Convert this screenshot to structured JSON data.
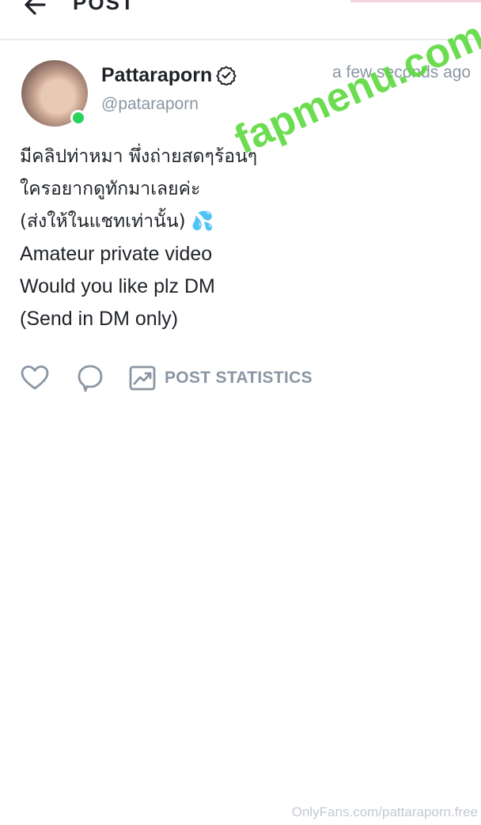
{
  "header": {
    "title": "POST",
    "back_icon": "arrow-left-icon"
  },
  "post": {
    "author": {
      "display_name": "Pattaraporn",
      "username": "@pataraporn",
      "verified_icon": "verified-badge-icon",
      "online": true,
      "online_color": "#2bd35b"
    },
    "timestamp": "a few seconds ago",
    "text_lines": [
      "มีคลิปท่าหมา พึ่งถ่ายสดๆร้อนๆ",
      "ใครอยากดูทักมาเลยค่ะ",
      "(ส่งให้ในแชทเท่านั้น) 💦",
      "Amateur private video",
      "Would you like plz DM",
      "(Send in DM only)"
    ],
    "actions": {
      "like_icon": "heart-icon",
      "comment_icon": "comment-icon",
      "stats_icon": "chart-icon",
      "stats_label": "POST STATISTICS"
    }
  },
  "watermark": "fapmenu.com",
  "footer_credit": "OnlyFans.com/pattaraporn.free",
  "colors": {
    "text_primary": "#1f2328",
    "text_muted": "#8a96a3",
    "watermark": "#5cd83e",
    "divider": "#e9ecef"
  }
}
